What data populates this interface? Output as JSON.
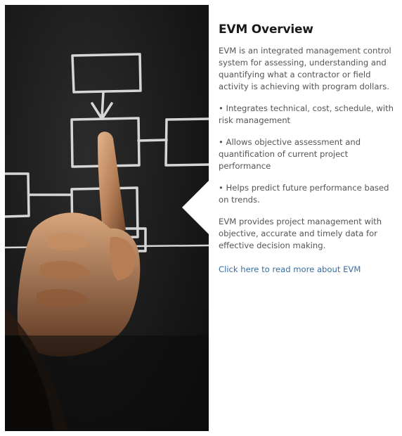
{
  "panel": {
    "title": "EVM Overview",
    "intro": "EVM is an integrated management control system for assessing, understanding and quantifying what a contractor or field activity is achieving with program dollars.",
    "bullets": [
      {
        "dot": "•",
        "text": "Integrates technical, cost, schedule, with risk management"
      },
      {
        "dot": "•",
        "text": "Allows objective assessment and quantification of current project performance"
      },
      {
        "dot": "•",
        "text": "Helps predict future performance based on trends."
      }
    ],
    "summary": "EVM provides project management with objective, accurate and timely data for effective decision making.",
    "link_label": "Click here to read more about EVM"
  },
  "colors": {
    "link": "#3a6ea5",
    "text": "#555555",
    "title": "#1a1a1a",
    "chalkboard": "#1a1a1a",
    "chalk": "#e8e8e8"
  },
  "icons": {
    "hand": "pointing-hand-icon",
    "diagram": "flowchart-icon"
  }
}
